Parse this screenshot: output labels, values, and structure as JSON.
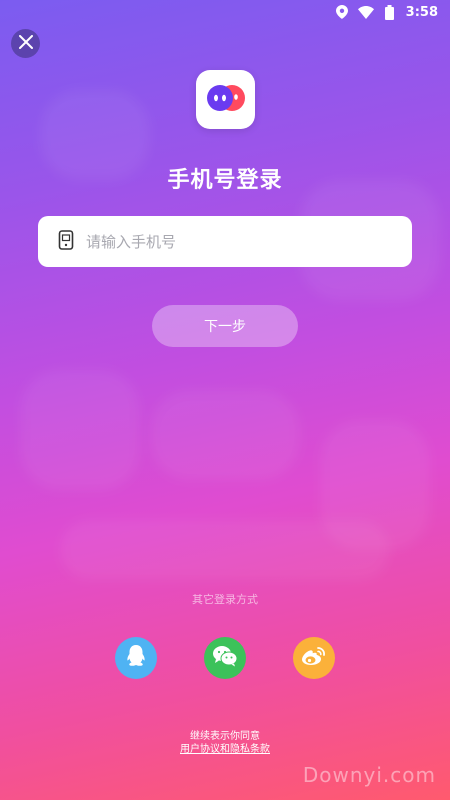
{
  "status_bar": {
    "time": "3:58",
    "icons": [
      "location-icon",
      "wifi-icon",
      "battery-icon"
    ]
  },
  "header": {
    "close_icon": "close-icon"
  },
  "logo": {
    "icon": "app-logo-icon"
  },
  "title": "手机号登录",
  "phone": {
    "placeholder": "请输入手机号",
    "value": "",
    "icon": "phone-icon"
  },
  "next_button": {
    "label": "下一步"
  },
  "other_login": {
    "label": "其它登录方式",
    "options": [
      {
        "id": "qq",
        "icon": "qq-icon",
        "color": "#4fb3f3"
      },
      {
        "id": "wechat",
        "icon": "wechat-icon",
        "color": "#3cc25a"
      },
      {
        "id": "weibo",
        "icon": "weibo-icon",
        "color": "#fbb13a"
      }
    ]
  },
  "agreement": {
    "line1": "继续表示你同意",
    "link": "用户协议和隐私条款"
  },
  "watermark": "Downyi.com",
  "colors": {
    "gradient_top": "#7b5cf0",
    "gradient_mid": "#e04cd0",
    "gradient_bottom": "#ff5a6e"
  }
}
